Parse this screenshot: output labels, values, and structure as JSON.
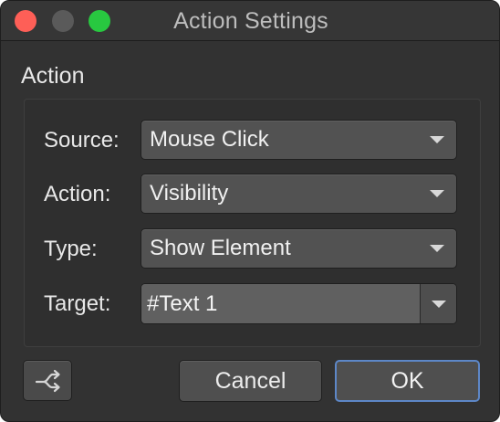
{
  "window": {
    "title": "Action Settings"
  },
  "section": {
    "label": "Action"
  },
  "rows": {
    "source": {
      "label": "Source:",
      "value": "Mouse Click"
    },
    "action": {
      "label": "Action:",
      "value": "Visibility"
    },
    "type": {
      "label": "Type:",
      "value": "Show Element"
    },
    "target": {
      "label": "Target:",
      "value": "#Text 1"
    }
  },
  "buttons": {
    "cancel": "Cancel",
    "ok": "OK",
    "shuffle_icon": "shuffle-icon"
  },
  "colors": {
    "window_bg": "#323232",
    "close": "#fe5f57",
    "zoom": "#28c840",
    "default_button_border": "#5d87c7"
  }
}
